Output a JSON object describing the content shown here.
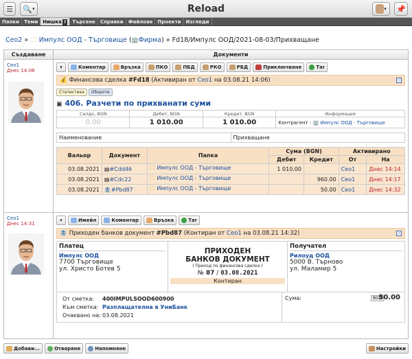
{
  "window": {
    "title": "Reload"
  },
  "tabs": [
    {
      "label": "Папки",
      "active": false
    },
    {
      "label": "Теми",
      "active": false
    },
    {
      "label": "Нишка",
      "active": true,
      "badge": "?"
    },
    {
      "label": "Търсене",
      "active": false
    },
    {
      "label": "Справки",
      "active": false
    },
    {
      "label": "Файлове",
      "active": false
    },
    {
      "label": "Проекти",
      "active": false
    },
    {
      "label": "Изгледи",
      "active": false
    }
  ],
  "breadcrumb": {
    "root": "Ceo2",
    "sep": "»",
    "company": "Импулс ООД - Търговище",
    "company_type": "Фирма",
    "tail": "» Fd18/Импулс ООД/2021-08-03/Прихващане"
  },
  "columns": {
    "created": "Създаване",
    "documents": "Документи"
  },
  "thread1": {
    "user": "Ceo1",
    "date": "Днес 14:06",
    "buttons": [
      "Коментар",
      "Връзка",
      "ПКО",
      "ПБД",
      "РКО",
      "РБД",
      "Приключване",
      "Таг"
    ],
    "doc_prefix": "Финансова сделка",
    "doc_no": "#Fd18",
    "doc_status": "(Активиран от",
    "doc_user": "Ceo1",
    "doc_time": "на 03.08.21 14:06)",
    "pills": [
      "Статистика",
      "Обороти"
    ],
    "heading": "406. Разчети по прихванати суми",
    "summary": {
      "labels": [
        "Салдо, BGN",
        "Дебит, BGN",
        "Кредит, BGN",
        "Информация"
      ],
      "saldo": "0.00",
      "debit": "1 010.00",
      "credit": "1 010.00",
      "contractor_label": "Контрагент :",
      "contractor": "Импулс ООД - Търговище"
    },
    "name_label": "Наименование",
    "name_value": "Прихващане",
    "ops_headers": {
      "valor": "Вальор",
      "doc": "Документ",
      "folder": "Папка",
      "sum": "Сума (BGN)",
      "activated": "Активирано",
      "debit": "Дебит",
      "credit": "Кредит",
      "from": "От",
      "on": "На"
    },
    "ops": [
      {
        "valor": "03.08.2021",
        "doc": "#Cdd46",
        "folder": "Импулс ООД - Търговище",
        "debit": "1 010.00",
        "credit": "",
        "from": "Ceo1",
        "on": "Днес 14:14"
      },
      {
        "valor": "03.08.2021",
        "doc": "#Cdc22",
        "folder": "Импулс ООД - Търговище",
        "debit": "",
        "credit": "960.00",
        "from": "Ceo1",
        "on": "Днес 14:17"
      },
      {
        "valor": "03.08.2021",
        "doc": "#Pbd87",
        "folder": "Импулс ООД - Търговище",
        "debit": "",
        "credit": "50.00",
        "from": "Ceo1",
        "on": "Днес 14:32"
      }
    ]
  },
  "thread2": {
    "user": "Ceo1",
    "date": "Днес 14:31",
    "buttons": [
      "Имейл",
      "Коментар",
      "Връзка",
      "Таг"
    ],
    "doc_prefix": "Приходен банков документ",
    "doc_no": "#Pbd87",
    "doc_status": "(Контиран от",
    "doc_user": "Ceo1",
    "doc_time": "на 03.08.21 14:32)",
    "payer_label": "Платец",
    "payer_name": "Импулс ООД",
    "payer_city": "7700 Търговище",
    "payer_street": "ул. Христо Ботев 5",
    "doc_title1": "ПРИХОДЕН",
    "doc_title2": "БАНКОВ ДОКУМЕНТ",
    "doc_subtitle": "( Приход по финансова сделка )",
    "doc_num_prefix": "№",
    "doc_num": "87",
    "doc_num_sep": "/",
    "doc_date": "03.08.2021",
    "doc_state": "Контиран",
    "receiver_label": "Получател",
    "receiver_name": "Рилоуд ООД",
    "receiver_city": "5000 В. Търново",
    "receiver_street": "ул. Маламир 5",
    "from_acct_label": "От сметка:",
    "from_acct": "400IMPULSOOD600900",
    "to_acct_label": "Към сметка:",
    "to_acct": "Разплащателна в УниБанк",
    "expected_label": "Очаквано на:",
    "expected": "03.08.2021",
    "sum_label": "Сума:",
    "currency": "BGN",
    "sum": "50.00"
  },
  "footer": {
    "add": "Добави...",
    "open": "Отваряне",
    "remind": "Напомняне",
    "settings": "Настройки"
  }
}
